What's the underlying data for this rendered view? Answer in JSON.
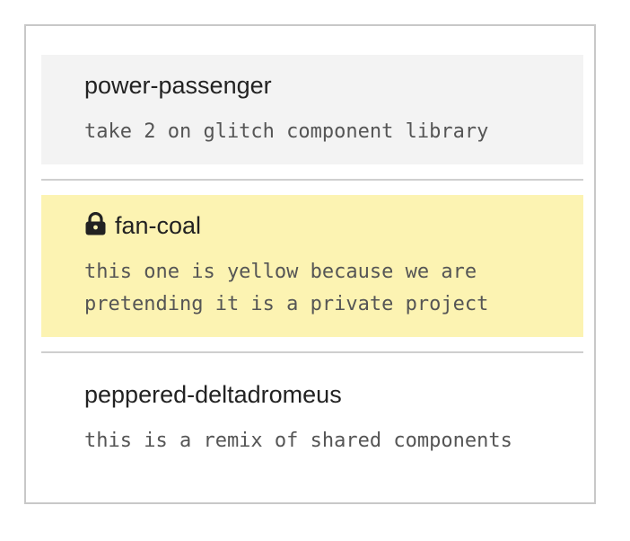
{
  "projects": [
    {
      "name": "power-passenger",
      "description": "take 2 on glitch component library",
      "private": false,
      "background": "#f3f3f3"
    },
    {
      "name": "fan-coal",
      "description": "this one is yellow because we are pretending it is a private project",
      "private": true,
      "icon": "lock-icon",
      "background": "#fcf3b2"
    },
    {
      "name": "peppered-deltadromeus",
      "description": "this is a remix of shared components",
      "private": false,
      "background": "#ffffff"
    }
  ],
  "colors": {
    "border": "#c8c8c8",
    "divider": "#cfcfcf",
    "title_text": "#222222",
    "description_text": "#555555"
  }
}
